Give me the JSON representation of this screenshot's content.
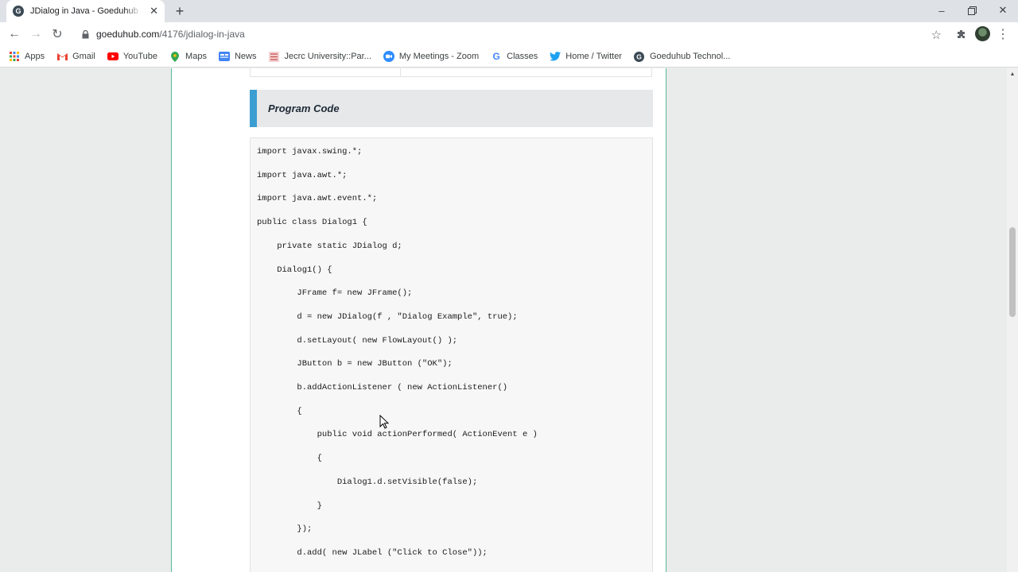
{
  "browser": {
    "tab": {
      "favicon_letter": "G",
      "title": "JDialog in Java - Goeduhub Technologies"
    },
    "address": {
      "domain": "goeduhub.com",
      "path": "/4176/jdialog-in-java"
    },
    "bookmarks": [
      {
        "label": "Apps",
        "icon": "apps-grid-icon"
      },
      {
        "label": "Gmail",
        "icon": "gmail-icon"
      },
      {
        "label": "YouTube",
        "icon": "youtube-icon"
      },
      {
        "label": "Maps",
        "icon": "maps-pin-icon"
      },
      {
        "label": "News",
        "icon": "news-icon"
      },
      {
        "label": "Jecrc University::Par...",
        "icon": "jecrc-icon"
      },
      {
        "label": "My Meetings - Zoom",
        "icon": "zoom-icon"
      },
      {
        "label": "Classes",
        "icon": "google-g-icon"
      },
      {
        "label": "Home / Twitter",
        "icon": "twitter-icon"
      },
      {
        "label": "Goeduhub Technol...",
        "icon": "goeduhub-icon"
      }
    ]
  },
  "article": {
    "section_title": "Program Code",
    "code_lines": [
      "import javax.swing.*;",
      "import java.awt.*;",
      "import java.awt.event.*;",
      "public class Dialog1 {",
      "    private static JDialog d;",
      "    Dialog1() {",
      "        JFrame f= new JFrame();",
      "        d = new JDialog(f , \"Dialog Example\", true);",
      "        d.setLayout( new FlowLayout() );",
      "        JButton b = new JButton (\"OK\");",
      "        b.addActionListener ( new ActionListener()",
      "        {",
      "            public void actionPerformed( ActionEvent e )",
      "            {",
      "                Dialog1.d.setVisible(false);",
      "            }",
      "        });",
      "        d.add( new JLabel (\"Click to Close\"));"
    ]
  },
  "colors": {
    "accent_bar": "#3b9ed3",
    "column_border": "#5cb89d"
  }
}
